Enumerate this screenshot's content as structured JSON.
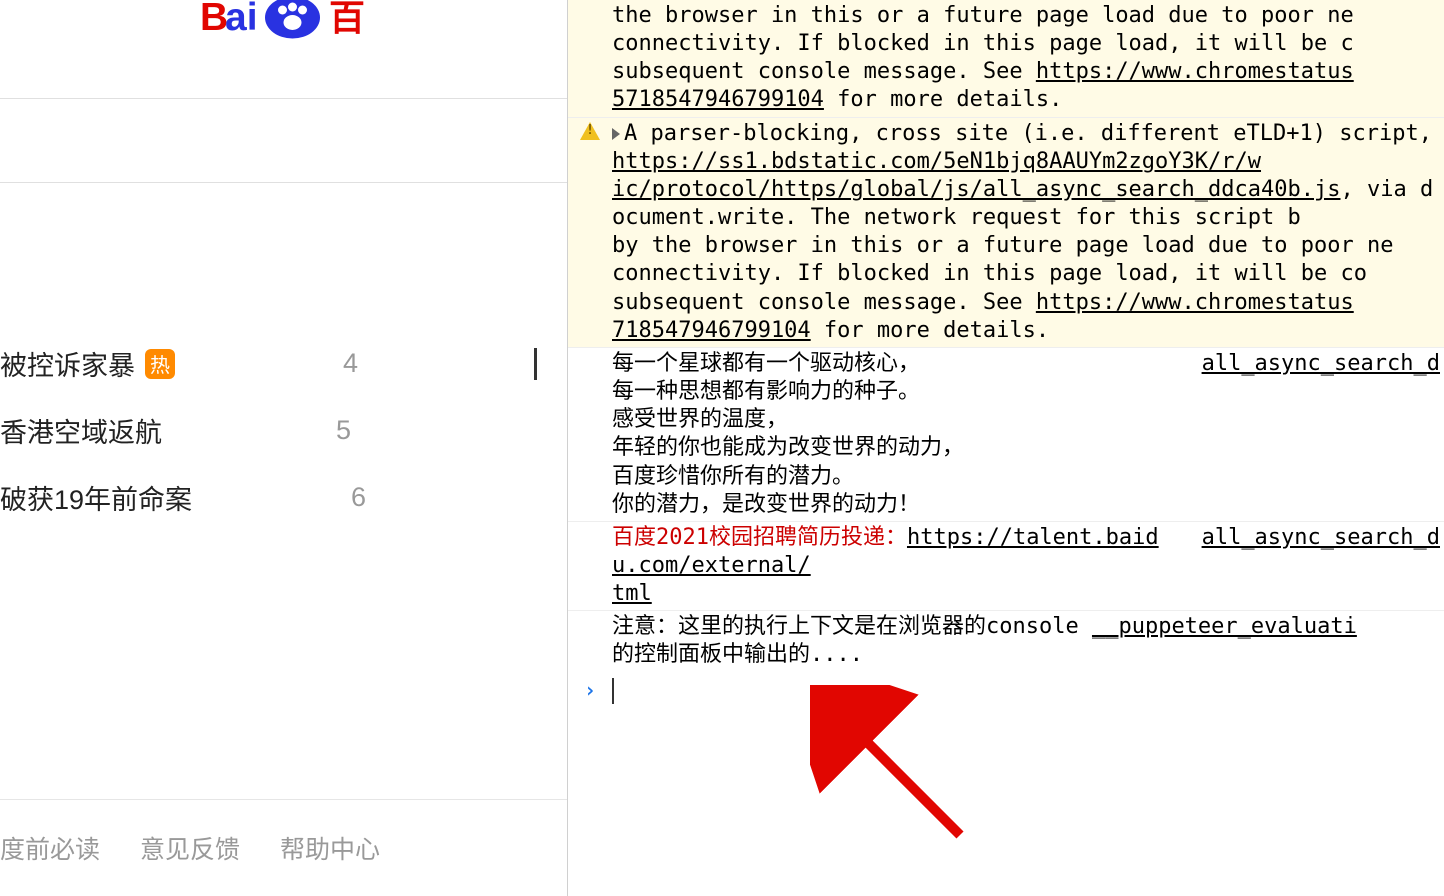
{
  "logo": {
    "text_prefix": "Bai",
    "text_suffix": "百",
    "brand_blue": "#2932e1",
    "brand_red": "#e10601"
  },
  "hot_list": {
    "items": [
      {
        "title_fragment": "被控诉家暴",
        "badge": "热",
        "num": "4"
      },
      {
        "title_fragment": "香港空域返航",
        "num": "5"
      },
      {
        "title_fragment": "破获19年前命案",
        "num": "6"
      }
    ]
  },
  "footer": {
    "links": [
      "度前必读",
      "意见反馈",
      "帮助中心"
    ]
  },
  "console": {
    "warn1": {
      "text": "the browser in this or a future page load due to poor ne\nconnectivity. If blocked in this page load, it will be c\nsubsequent console message. See ",
      "link1": "https://www.chromestatus",
      "link2": "5718547946799104",
      "tail": " for more details."
    },
    "warn2": {
      "pre": "A parser-blocking, cross site (i.e. different eTLD+1) script, ",
      "script_link": "https://ss1.bdstatic.com/5eN1bjq8AAUYm2zgoY3K/r/w\nic/protocol/https/global/js/all_async_search_ddca40b.js",
      "mid": ", via document.write. The network request for this script b\nby the browser in this or a future page load due to poor ne\nconnectivity. If blocked in this page load, it will be co\nsubsequent console message. See ",
      "link1": "https://www.chromestatus",
      "link2": "718547946799104",
      "tail": " for more details."
    },
    "log1": {
      "text": "每一个星球都有一个驱动核心，\n每一种思想都有影响力的种子。\n感受世界的温度，\n年轻的你也能成为改变世界的动力，\n百度珍惜你所有的潜力。\n你的潜力，是改变世界的动力！",
      "source": "all_async_search_d"
    },
    "log2": {
      "red": "百度2021校园招聘简历投递：",
      "link": "https://talent.baidu.com/external/",
      "link_tail": "tml",
      "source": "all_async_search_d"
    },
    "log3": {
      "text": "注意：这里的执行上下文是在浏览器的console ",
      "link": "__puppeteer_evaluati",
      "text2": "的控制面板中输出的...."
    }
  },
  "arrow_color": "#e10601"
}
